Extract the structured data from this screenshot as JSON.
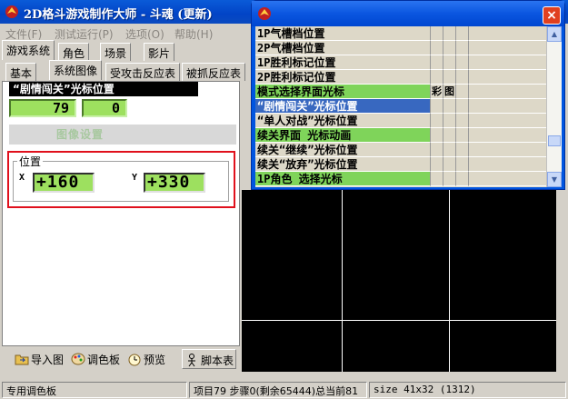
{
  "app": {
    "title": "2D格斗游戏制作大师 - 斗魂 (更新)"
  },
  "menu": [
    "文件(F)",
    "测试运行(P)",
    "选项(O)",
    "帮助(H)"
  ],
  "tabs_top": [
    "游戏系统",
    "角色",
    "场景",
    "影片"
  ],
  "tabs_sub": [
    "基本",
    "系统图像",
    "受攻击反应表",
    "被抓反应表"
  ],
  "panel": {
    "current_item": "“剧情闯关”光标位置",
    "value_a": "79",
    "value_b": "0",
    "grey_label": "图像设置",
    "position_group": "位置",
    "x_label": "X",
    "x_value": "+160",
    "y_label": "Y",
    "y_value": "+330"
  },
  "bottom_buttons": [
    {
      "label": "导入图",
      "icon": "folder-import-icon"
    },
    {
      "label": "调色板",
      "icon": "palette-icon"
    },
    {
      "label": "预览",
      "icon": "clock-preview-icon"
    },
    {
      "label": "脚本表",
      "icon": "script-table-icon"
    }
  ],
  "status": {
    "left": "专用调色板",
    "middle": "项目79 步骤0(剩余65444)总当前81",
    "right": "size 41x32 (1312)"
  },
  "popup": {
    "close": "×",
    "rows": [
      {
        "name": "1P气槽档位置",
        "c1": "",
        "c2": ""
      },
      {
        "name": "2P气槽档位置",
        "c1": "",
        "c2": ""
      },
      {
        "name": "1P胜利标记位置",
        "c1": "",
        "c2": ""
      },
      {
        "name": "2P胜利标记位置",
        "c1": "",
        "c2": ""
      },
      {
        "name": "模式选择界面光标",
        "c1": "彩",
        "c2": "图"
      },
      {
        "name": "“剧情闯关”光标位置",
        "c1": "",
        "c2": ""
      },
      {
        "name": "“单人对战”光标位置",
        "c1": "",
        "c2": ""
      },
      {
        "name": "续关界面 光标动画",
        "c1": "",
        "c2": ""
      },
      {
        "name": "续关“继续”光标位置",
        "c1": "",
        "c2": ""
      },
      {
        "name": "续关“放弃”光标位置",
        "c1": "",
        "c2": ""
      },
      {
        "name": "1P角色 选择光标",
        "c1": "",
        "c2": ""
      }
    ],
    "highlight_rows": [
      4,
      7,
      10
    ],
    "selected_row": 5
  },
  "colors": {
    "value_green": "#9de05f",
    "row_green": "#7fd45a",
    "selected_blue": "#3868c0",
    "frame_red": "#e0101c"
  }
}
